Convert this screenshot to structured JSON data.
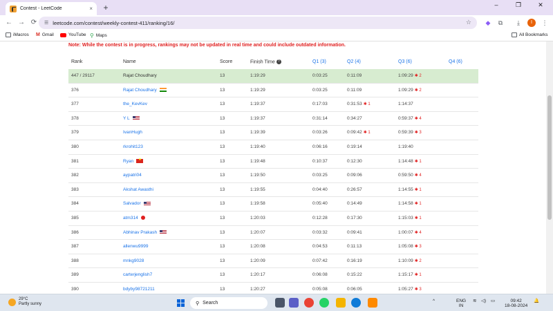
{
  "browser": {
    "tab_title": "Contest - LeetCode",
    "tab_close": "×",
    "new_tab": "+",
    "url": "leetcode.com/contest/weekly-contest-411/ranking/16/",
    "profile_initial": "I",
    "win_min": "–",
    "win_max": "❐",
    "win_close": "✕"
  },
  "bookmarks": [
    {
      "label": "iMacros",
      "icon": "folder-icon"
    },
    {
      "label": "Gmail",
      "icon": "gmail-icon"
    },
    {
      "label": "YouTube",
      "icon": "youtube-icon"
    },
    {
      "label": "Maps",
      "icon": "maps-icon"
    }
  ],
  "all_bookmarks": "All Bookmarks",
  "note": "Note: While the contest is in progress, rankings may not be updated in real time and could include outdated information.",
  "table": {
    "headers": {
      "rank": "Rank",
      "name": "Name",
      "score": "Score",
      "finish": "Finish Time",
      "q1": "Q1 (3)",
      "q2": "Q2 (4)",
      "q3": "Q3 (6)",
      "q4": "Q4 (6)"
    },
    "rows": [
      {
        "rank": "447 / 29117",
        "name": "Rajat Choudhary",
        "score": "13",
        "finish": "1:19:29",
        "q1": "0:03:25",
        "q2": "0:11:09",
        "q2_bug": "",
        "q3": "1:09:29",
        "q3_bug": "2",
        "flag": "",
        "me": true
      },
      {
        "rank": "376",
        "name": "Rajat Choudhary",
        "score": "13",
        "finish": "1:19:29",
        "q1": "0:03:25",
        "q2": "0:11:09",
        "q2_bug": "",
        "q3": "1:09:29",
        "q3_bug": "2",
        "flag": "in",
        "me": false
      },
      {
        "rank": "377",
        "name": "the_KevKev",
        "score": "13",
        "finish": "1:19:37",
        "q1": "0:17:03",
        "q2": "0:31:53",
        "q2_bug": "1",
        "q3": "1:14:37",
        "q3_bug": "",
        "flag": "",
        "me": false
      },
      {
        "rank": "378",
        "name": "Y L",
        "score": "13",
        "finish": "1:19:37",
        "q1": "0:31:14",
        "q2": "0:34:27",
        "q2_bug": "",
        "q3": "0:59:37",
        "q3_bug": "4",
        "flag": "us",
        "me": false
      },
      {
        "rank": "379",
        "name": "IvanHugh",
        "score": "13",
        "finish": "1:19:39",
        "q1": "0:03:26",
        "q2": "0:09:42",
        "q2_bug": "1",
        "q3": "0:59:39",
        "q3_bug": "3",
        "flag": "",
        "me": false
      },
      {
        "rank": "380",
        "name": "rkrohit123",
        "score": "13",
        "finish": "1:19:40",
        "q1": "0:06:16",
        "q2": "0:19:14",
        "q2_bug": "",
        "q3": "1:19:40",
        "q3_bug": "",
        "flag": "",
        "me": false
      },
      {
        "rank": "381",
        "name": "Ryan",
        "score": "13",
        "finish": "1:19:48",
        "q1": "0:10:37",
        "q2": "0:12:30",
        "q2_bug": "",
        "q3": "1:14:48",
        "q3_bug": "1",
        "flag": "vn",
        "me": false
      },
      {
        "rank": "382",
        "name": "aypatri04",
        "score": "13",
        "finish": "1:19:50",
        "q1": "0:03:25",
        "q2": "0:09:06",
        "q2_bug": "",
        "q3": "0:59:50",
        "q3_bug": "4",
        "flag": "",
        "me": false
      },
      {
        "rank": "383",
        "name": "Akshat Awasthi",
        "score": "13",
        "finish": "1:19:55",
        "q1": "0:04:40",
        "q2": "0:26:57",
        "q2_bug": "",
        "q3": "1:14:55",
        "q3_bug": "1",
        "flag": "",
        "me": false
      },
      {
        "rank": "384",
        "name": "Salvador",
        "score": "13",
        "finish": "1:19:58",
        "q1": "0:05:40",
        "q2": "0:14:49",
        "q2_bug": "",
        "q3": "1:14:58",
        "q3_bug": "1",
        "flag": "us",
        "me": false
      },
      {
        "rank": "385",
        "name": "atm314",
        "score": "13",
        "finish": "1:20:03",
        "q1": "0:12:28",
        "q2": "0:17:30",
        "q2_bug": "",
        "q3": "1:15:03",
        "q3_bug": "1",
        "flag": "jp",
        "me": false
      },
      {
        "rank": "386",
        "name": "Abhinav Prakash",
        "score": "13",
        "finish": "1:20:07",
        "q1": "0:03:32",
        "q2": "0:09:41",
        "q2_bug": "",
        "q3": "1:00:07",
        "q3_bug": "4",
        "flag": "us",
        "me": false
      },
      {
        "rank": "387",
        "name": "allenwu9999",
        "score": "13",
        "finish": "1:20:08",
        "q1": "0:04:53",
        "q2": "0:11:13",
        "q2_bug": "",
        "q3": "1:05:08",
        "q3_bug": "3",
        "flag": "",
        "me": false
      },
      {
        "rank": "388",
        "name": "mnkg9028",
        "score": "13",
        "finish": "1:20:09",
        "q1": "0:07:42",
        "q2": "0:16:19",
        "q2_bug": "",
        "q3": "1:10:09",
        "q3_bug": "2",
        "flag": "",
        "me": false
      },
      {
        "rank": "389",
        "name": "carterjenglish7",
        "score": "13",
        "finish": "1:20:17",
        "q1": "0:06:08",
        "q2": "0:15:22",
        "q2_bug": "",
        "q3": "1:15:17",
        "q3_bug": "1",
        "flag": "",
        "me": false
      },
      {
        "rank": "390",
        "name": "bdyby98721211",
        "score": "13",
        "finish": "1:20:27",
        "q1": "0:05:08",
        "q2": "0:06:05",
        "q2_bug": "",
        "q3": "1:05:27",
        "q3_bug": "3",
        "flag": "",
        "me": false
      }
    ]
  },
  "taskbar": {
    "weather_temp": "29°C",
    "weather_desc": "Partly sunny",
    "search": "Search",
    "lang": "ENG",
    "region": "IN",
    "time": "09:42",
    "date": "18-08-2024"
  },
  "colors": {
    "accent": "#1a73e8",
    "note": "#e02020",
    "highlight_row": "#d7ecd0"
  }
}
